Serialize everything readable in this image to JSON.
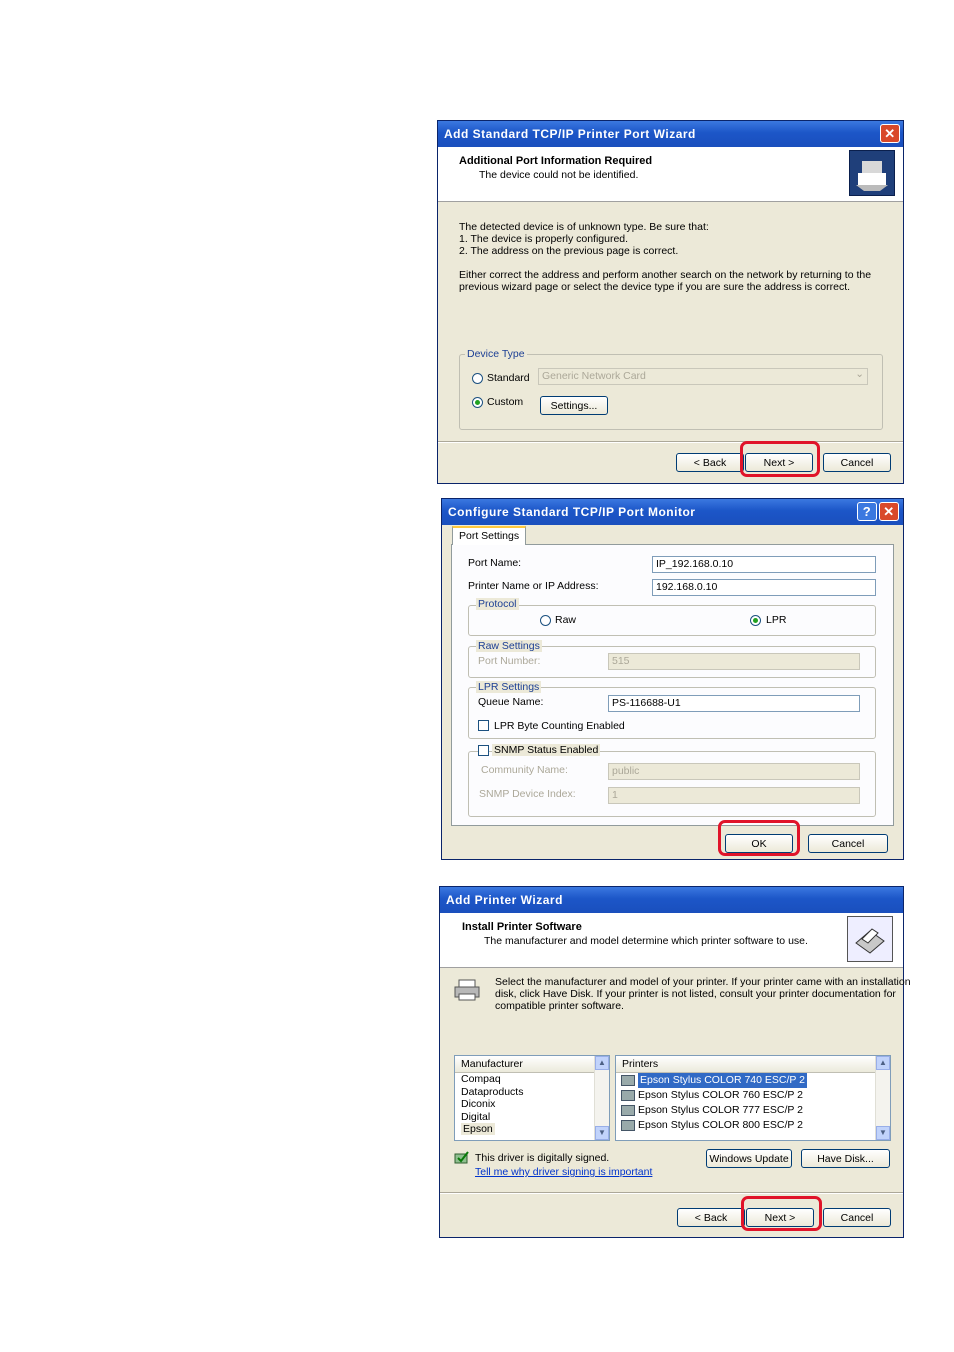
{
  "wizard1": {
    "title": "Add Standard TCP/IP Printer Port Wizard",
    "close": "✕",
    "header_title": "Additional Port Information Required",
    "header_sub": "The device could not be identified.",
    "line1": "The detected device is of unknown type.  Be sure that:",
    "line2": "1. The device is properly configured.",
    "line3": "2.  The address on the previous page is correct.",
    "line4": "Either correct the address and perform another search on the network by returning to the",
    "line5": "previous wizard page or select the device type if you are sure the address is correct.",
    "group_label": "Device Type",
    "standard_label": "Standard",
    "standard_value": "Generic Network Card",
    "dropdown_arrow": "⌄",
    "custom_label": "Custom",
    "settings_button": "Settings...",
    "back_button": "< Back",
    "next_button": "Next >",
    "cancel_button": "Cancel"
  },
  "monitor": {
    "title": "Configure Standard TCP/IP Port Monitor",
    "help": "?",
    "close": "✕",
    "tab": "Port Settings",
    "port_name_label": "Port Name:",
    "port_name_value": "IP_192.168.0.10",
    "address_label": "Printer Name or IP Address:",
    "address_value": "192.168.0.10",
    "protocol_label": "Protocol",
    "raw_label": "Raw",
    "lpr_label": "LPR",
    "raw_settings_label": "Raw Settings",
    "port_number_label": "Port Number:",
    "port_number_value": "515",
    "lpr_settings_label": "LPR Settings",
    "queue_label": "Queue Name:",
    "queue_value": "PS-116688-U1",
    "byte_counting_label": "LPR Byte Counting Enabled",
    "snmp_label": "SNMP Status Enabled",
    "community_label": "Community Name:",
    "community_value": "public",
    "snmp_index_label": "SNMP Device Index:",
    "snmp_index_value": "1",
    "ok_button": "OK",
    "cancel_button": "Cancel"
  },
  "wizard2": {
    "title": "Add Printer Wizard",
    "header_title": "Install Printer Software",
    "header_sub": "The manufacturer and model determine which printer software to use.",
    "desc1": "Select the manufacturer and model of your printer. If your printer came with an installation",
    "desc2": "disk, click Have Disk. If your printer is not listed, consult your printer documentation for",
    "desc3": "compatible printer software.",
    "manufacturer_header": "Manufacturer",
    "manufacturers": [
      "Compaq",
      "Dataproducts",
      "Diconix",
      "Digital",
      "Epson"
    ],
    "printers_header": "Printers",
    "printers": [
      "Epson Stylus COLOR 740 ESC/P 2",
      "Epson Stylus COLOR 760 ESC/P 2",
      "Epson Stylus COLOR 777 ESC/P 2",
      "Epson Stylus COLOR 800 ESC/P 2"
    ],
    "scroll_up": "▲",
    "scroll_down": "▼",
    "signed_text": "This driver is digitally signed.",
    "signing_link": "Tell me why driver signing is important",
    "windows_update_button": "Windows Update",
    "have_disk_button": "Have Disk...",
    "back_button": "< Back",
    "next_button": "Next >",
    "cancel_button": "Cancel"
  }
}
